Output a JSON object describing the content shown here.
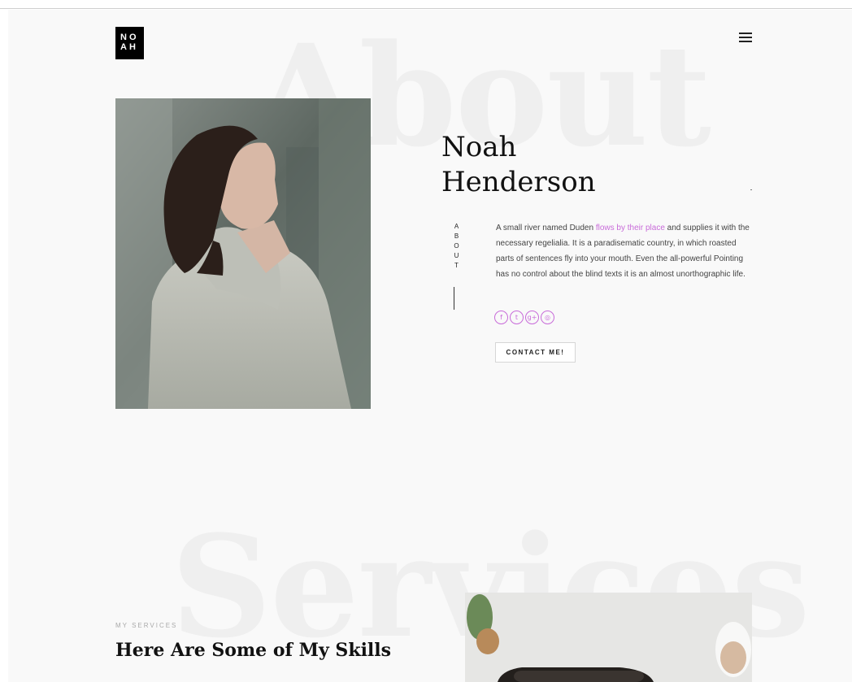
{
  "brand": {
    "logo_line1": "NO",
    "logo_line2": "AH"
  },
  "about": {
    "background_word": "About",
    "name_line1": "Noah",
    "name_line2": "Henderson",
    "section_label": "ABOUT",
    "bio_part1": "A small river named Duden ",
    "bio_link": "flows by their place",
    "bio_part2": " and supplies it with the necessary regelialia. It is a paradisematic country, in which roasted parts of sentences fly into your mouth. Even the all-powerful Pointing has no control about the blind texts it is an almost unorthographic life.",
    "socials": [
      {
        "icon": "facebook-icon",
        "glyph": "f"
      },
      {
        "icon": "twitter-icon",
        "glyph": "t"
      },
      {
        "icon": "google-plus-icon",
        "glyph": "g+"
      },
      {
        "icon": "instagram-icon",
        "glyph": "◎"
      }
    ],
    "contact_button": "CONTACT ME!"
  },
  "services": {
    "background_word": "Services",
    "eyebrow": "MY SERVICES",
    "heading": "Here Are Some of My Skills"
  },
  "colors": {
    "accent": "#c86bd9",
    "page_background": "#f9f9f9",
    "watermark_text": "#efefef"
  }
}
